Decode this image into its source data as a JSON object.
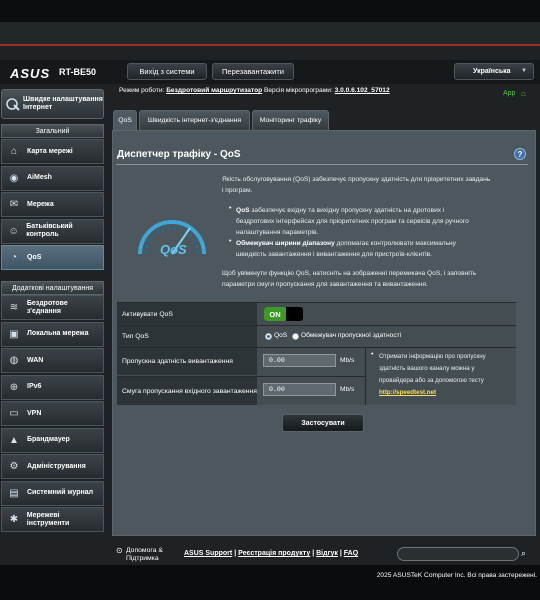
{
  "header": {
    "brand": "ASUS",
    "model": "RT-BE50",
    "logout": "Вихід з системи",
    "reboot": "Перезавантажити",
    "language": "Українська"
  },
  "status": {
    "op_mode_label": "Режим роботи:",
    "op_mode": "Бездротовий маршрутизатор",
    "fw_label": "Версія мікропрограми:",
    "fw": "3.0.0.6.102_57012",
    "app": "App"
  },
  "sidebar": {
    "quick_setup": "Швидке налаштування Інтернет",
    "general_header": "Загальний",
    "general": [
      {
        "label": "Карта мережі",
        "icon": "network-map-icon"
      },
      {
        "label": "AiMesh",
        "icon": "aimesh-icon"
      },
      {
        "label": "Мережа",
        "icon": "network-icon"
      },
      {
        "label": "Батьківський контроль",
        "icon": "parental-control-icon"
      },
      {
        "label": "QoS",
        "icon": "qos-icon"
      }
    ],
    "advanced_header": "Додаткові налаштування",
    "advanced": [
      {
        "label": "Бездротове з'єднання",
        "icon": "wireless-icon"
      },
      {
        "label": "Локальна мережа",
        "icon": "lan-icon"
      },
      {
        "label": "WAN",
        "icon": "wan-icon"
      },
      {
        "label": "IPv6",
        "icon": "ipv6-icon"
      },
      {
        "label": "VPN",
        "icon": "vpn-icon"
      },
      {
        "label": "Брандмауер",
        "icon": "firewall-icon"
      },
      {
        "label": "Адміністрування",
        "icon": "administration-icon"
      },
      {
        "label": "Системний журнал",
        "icon": "system-log-icon"
      },
      {
        "label": "Мережеві інструменти",
        "icon": "network-tools-icon"
      }
    ]
  },
  "tabs": [
    "QoS",
    "Швидкість інтернет-з'єднання",
    "Моніторинг трафіку"
  ],
  "panel": {
    "title": "Диспетчер трафіку - QoS",
    "intro_1": "Якість обслуговування (QoS) забезпечує пропускну здатність для пріоритетних завдань",
    "intro_2": "і програм.",
    "b1_bold": "QoS",
    "b1_1": " забезпечує вхідну та вихідну пропускну здатність на дротових і",
    "b1_2": "бездротових інтерфейсах для пріоритетних програм та сервісів для ручного",
    "b1_3": "налаштування параметрів.",
    "b2_bold": "Обмежувач ширини діапазону",
    "b2_1": " допомагає контролювати максимальну",
    "b2_2": "швидкість завантаження і вивантаження для пристроїв-клієнтів.",
    "outro_1": "Щоб увімкнути функцію QoS, натисніть на зображенні перемикача QoS, і заповніть",
    "outro_2": "параметри смуги пропускання для завантаження та вивантаження.",
    "gauge_label": "QoS"
  },
  "form": {
    "enable_label": "Активувати QoS",
    "enable_value": "ON",
    "type_label": "Тип QoS",
    "type_opt1": "QoS",
    "type_opt2": "Обмежувач пропускної здатності",
    "upload_label": "Пропускна здатність вивантаження",
    "upload_value": "0.00",
    "download_label": "Смуга пропускання вхідного завантаження",
    "download_value": "0.00",
    "unit": "Mb/s",
    "note_1": "Отримати інформацію про пропускну",
    "note_2": "здатність вашого каналу можна у",
    "note_3": "провайдера або за допомогою тесту",
    "note_link": "http://speedtest.net",
    "apply": "Застосувати"
  },
  "footer": {
    "help_1": "Допомога &",
    "help_2": "Підтримка",
    "link1": "ASUS Support",
    "link2": "Реєстрація продукту",
    "link3": "Відгук",
    "link4": "FAQ",
    "sep": "|",
    "copyright": "2025 ASUSTeK Computer Inc. Всі права застережені."
  }
}
